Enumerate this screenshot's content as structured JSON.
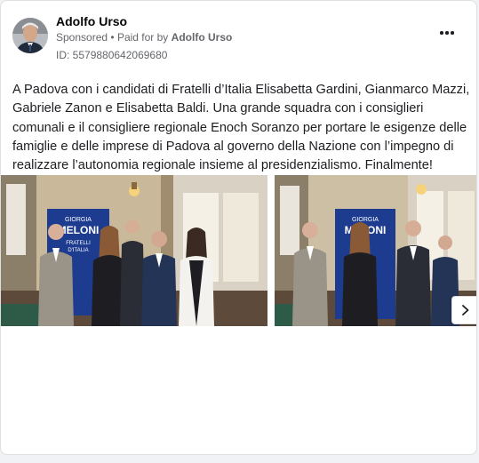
{
  "ad": {
    "page_name": "Adolfo Urso",
    "sponsored_label": "Sponsored",
    "separator": "•",
    "paid_for_prefix": "Paid for by",
    "paid_for_name": "Adolfo Urso",
    "library_id": "ID: 557988064206968​0",
    "body": "A Padova con i candidati di Fratelli d’Italia Elisabetta Gardini, Gianmarco Mazzi, Gabriele Zanon e Elisabetta Baldi. Una grande squadra con i consiglieri comunali e il consigliere regionale Enoch Soranzo per portare le esigenze delle famiglie e delle imprese di Padova al governo della Nazione con l’impegno di realizzare l’autonomia regionale insieme al presidenzialismo. Finalmente!"
  },
  "carousel": {
    "banner_top": "GIORGIA",
    "banner_name": "MELONI",
    "banner_sub": "FRATELLI",
    "banner_sub2": "D'ITALIA",
    "photo_count": 2
  },
  "icons": {
    "more": "more-dots-icon",
    "next": "chevron-right-icon"
  },
  "colors": {
    "banner_blue": "#1d3b8f",
    "text_primary": "#1c1e21",
    "text_secondary": "#65676b"
  }
}
